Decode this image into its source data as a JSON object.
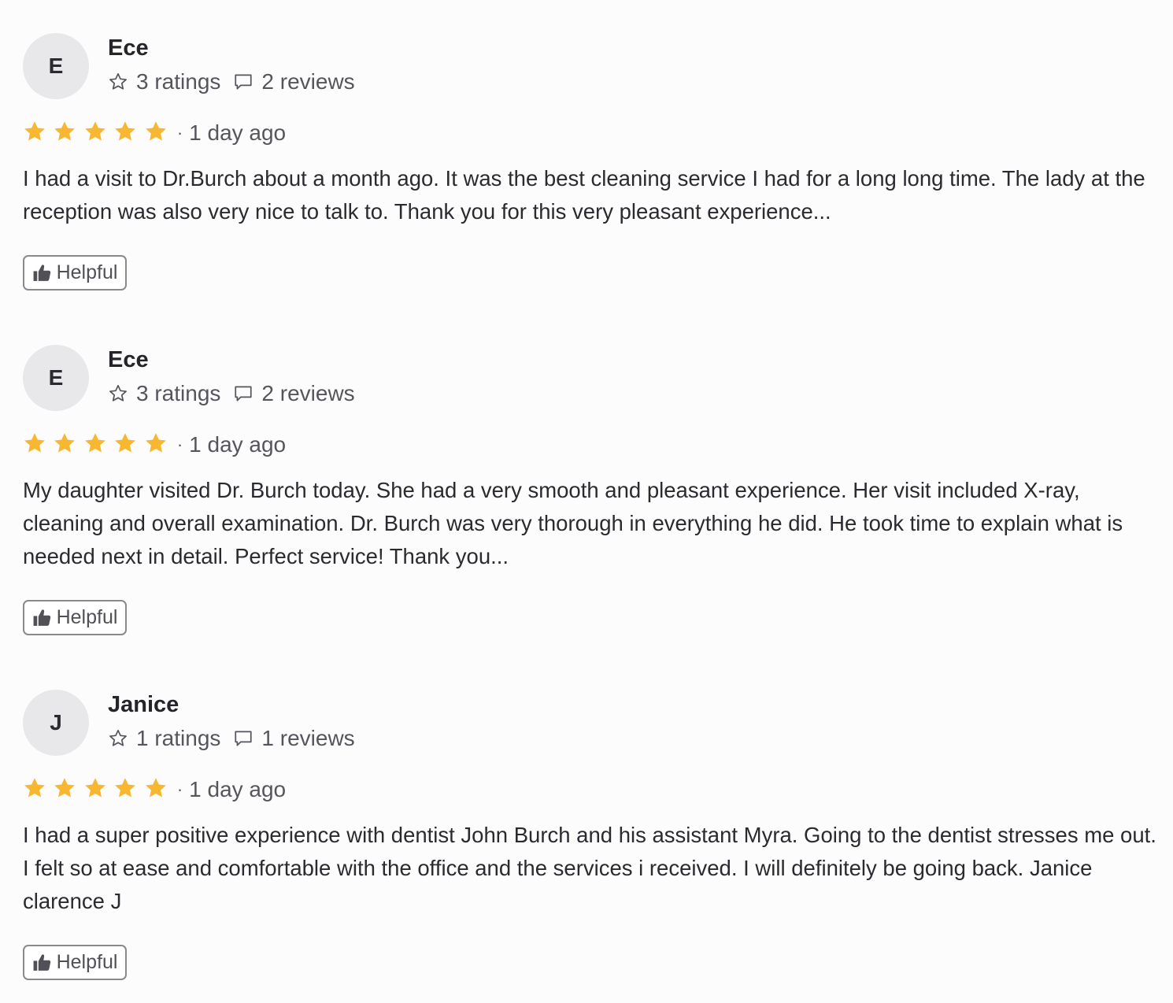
{
  "colors": {
    "star": "#f7b731",
    "avatar_bg": "#e8e8ea",
    "text": "#2a2a2f",
    "muted": "#55565c",
    "button_border": "#8a8a8e"
  },
  "icons": {
    "rating_stat": "star-outline-icon",
    "review_stat": "comment-icon",
    "rating_star": "star-icon",
    "helpful": "thumbs-up-icon"
  },
  "separator": "·",
  "reviews": [
    {
      "avatar_initial": "E",
      "name": "Ece",
      "ratings_count": "3 ratings",
      "reviews_count": "2 reviews",
      "stars": 5,
      "date": "1 day ago",
      "text": "I had a visit to Dr.Burch about a month ago. It was the best cleaning service I had for a long long time. The lady at the reception was also very nice to talk to. Thank you for this very pleasant experience...",
      "helpful_label": "Helpful"
    },
    {
      "avatar_initial": "E",
      "name": "Ece",
      "ratings_count": "3 ratings",
      "reviews_count": "2 reviews",
      "stars": 5,
      "date": "1 day ago",
      "text": "My daughter visited Dr. Burch today. She had a very smooth and pleasant experience. Her visit included X-ray, cleaning and overall examination. Dr. Burch was very thorough in everything he did. He took time to explain what is needed next in detail. Perfect service! Thank you...",
      "helpful_label": "Helpful"
    },
    {
      "avatar_initial": "J",
      "name": "Janice",
      "ratings_count": "1 ratings",
      "reviews_count": "1 reviews",
      "stars": 5,
      "date": "1 day ago",
      "text": "I had a super positive experience with dentist John Burch and his assistant Myra. Going to the dentist stresses me out. I felt so at ease and comfortable with the office and the services i received. I will definitely be going back. Janice clarence J",
      "helpful_label": "Helpful"
    }
  ]
}
